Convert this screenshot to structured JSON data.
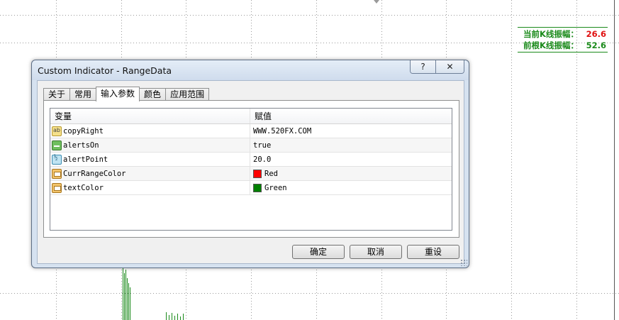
{
  "info_panel": {
    "rows": [
      {
        "label": "当前K线振幅：",
        "value": "26.6",
        "color": "#e01010"
      },
      {
        "label": "前根K线振幅：",
        "value": "52.6",
        "color": "#1a8a1a"
      }
    ]
  },
  "dialog": {
    "title": "Custom Indicator - RangeData",
    "help_label": "?",
    "close_label": "✕",
    "tabs": [
      "关于",
      "常用",
      "输入参数",
      "颜色",
      "应用范围"
    ],
    "active_tab": "输入参数",
    "grid": {
      "headers": [
        "变量",
        "赋值"
      ],
      "rows": [
        {
          "icon": "text-param-icon",
          "name": "copyRight",
          "value": "WWW.520FX.COM"
        },
        {
          "icon": "bool-param-icon",
          "name": "alertsOn",
          "value": "true"
        },
        {
          "icon": "number-param-icon",
          "name": "alertPoint",
          "value": "20.0"
        },
        {
          "icon": "color-param-icon",
          "name": "CurrRangeColor",
          "value": "Red",
          "swatch": "#ff0000"
        },
        {
          "icon": "color-param-icon",
          "name": "textColor",
          "value": "Green",
          "swatch": "#008000"
        }
      ]
    },
    "buttons": {
      "ok": "确定",
      "cancel": "取消",
      "reset": "重设"
    }
  }
}
